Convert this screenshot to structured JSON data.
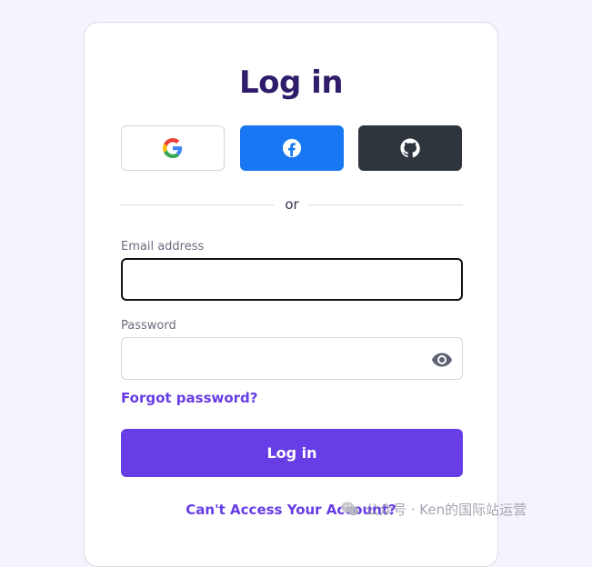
{
  "page": {
    "title": "Log in"
  },
  "social": {
    "google_icon": "google-icon",
    "facebook_icon": "facebook-icon",
    "github_icon": "github-icon",
    "facebook_color": "#1877f2",
    "github_color": "#2f353d"
  },
  "divider": {
    "text": "or"
  },
  "form": {
    "email_label": "Email address",
    "email_value": "",
    "password_label": "Password",
    "password_value": "",
    "show_password_icon": "eye-icon",
    "forgot_password": "Forgot password?",
    "submit_label": "Log in",
    "cant_access": "Can't Access Your Account?"
  },
  "watermark": {
    "text": "公众号 · Ken的国际站运营"
  },
  "colors": {
    "accent": "#673de6",
    "title": "#2f1c6a",
    "background": "#f4f4ff"
  }
}
